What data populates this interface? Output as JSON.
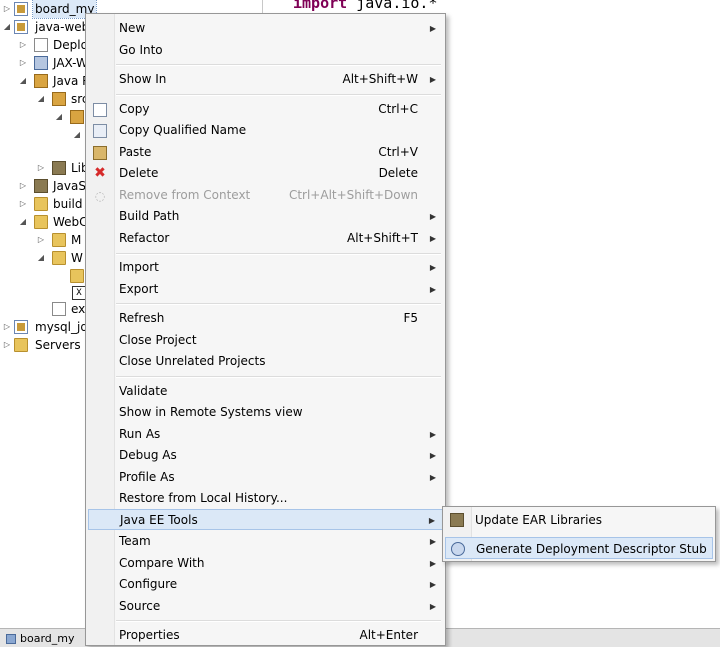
{
  "tree": {
    "items": [
      {
        "label": "board_my",
        "icon": "project-icon"
      },
      {
        "label": "java-webt",
        "icon": "project-icon"
      },
      {
        "label": "Deplo",
        "icon": "deployment-icon"
      },
      {
        "label": "JAX-W",
        "icon": "jaxws-icon"
      },
      {
        "label": "Java R",
        "icon": "java-resources-icon"
      },
      {
        "label": "src",
        "icon": "src-folder-icon"
      },
      {
        "label": "Lib",
        "icon": "library-icon"
      },
      {
        "label": "JavaSc",
        "icon": "javascript-icon"
      },
      {
        "label": "build",
        "icon": "folder-icon"
      },
      {
        "label": "WebC",
        "icon": "folder-icon"
      },
      {
        "label": "M",
        "icon": "folder-icon"
      },
      {
        "label": "W",
        "icon": "folder-icon"
      },
      {
        "label": "ex",
        "icon": "file-icon"
      },
      {
        "label": "mysql_jdb",
        "icon": "project-icon"
      },
      {
        "label": "Servers",
        "icon": "servers-icon"
      }
    ]
  },
  "editor": {
    "code_keyword": "import",
    "code_rest": " java.io.*"
  },
  "bottom_bar": {
    "tab_label": "board_my"
  },
  "context_menu": {
    "new": {
      "label": "New"
    },
    "go_into": {
      "label": "Go Into"
    },
    "show_in": {
      "label": "Show In",
      "shortcut": "Alt+Shift+W"
    },
    "copy": {
      "label": "Copy",
      "shortcut": "Ctrl+C"
    },
    "copy_qualified": {
      "label": "Copy Qualified Name"
    },
    "paste": {
      "label": "Paste",
      "shortcut": "Ctrl+V"
    },
    "delete": {
      "label": "Delete",
      "shortcut": "Delete"
    },
    "remove_context": {
      "label": "Remove from Context",
      "shortcut": "Ctrl+Alt+Shift+Down"
    },
    "build_path": {
      "label": "Build Path"
    },
    "refactor": {
      "label": "Refactor",
      "shortcut": "Alt+Shift+T"
    },
    "import": {
      "label": "Import"
    },
    "export": {
      "label": "Export"
    },
    "refresh": {
      "label": "Refresh",
      "shortcut": "F5"
    },
    "close_project": {
      "label": "Close Project"
    },
    "close_unrelated": {
      "label": "Close Unrelated Projects"
    },
    "validate": {
      "label": "Validate"
    },
    "show_remote": {
      "label": "Show in Remote Systems view"
    },
    "run_as": {
      "label": "Run As"
    },
    "debug_as": {
      "label": "Debug As"
    },
    "profile_as": {
      "label": "Profile As"
    },
    "restore_history": {
      "label": "Restore from Local History..."
    },
    "java_ee_tools": {
      "label": "Java EE Tools"
    },
    "team": {
      "label": "Team"
    },
    "compare_with": {
      "label": "Compare With"
    },
    "configure": {
      "label": "Configure"
    },
    "source": {
      "label": "Source"
    },
    "properties": {
      "label": "Properties",
      "shortcut": "Alt+Enter"
    }
  },
  "submenu": {
    "update_ear": {
      "label": "Update EAR Libraries"
    },
    "generate_dd": {
      "label": "Generate Deployment Descriptor Stub"
    }
  },
  "colors": {
    "highlight": "#dbe8f7",
    "delete_icon": "#d62a2a",
    "keyword": "#7f0055"
  }
}
